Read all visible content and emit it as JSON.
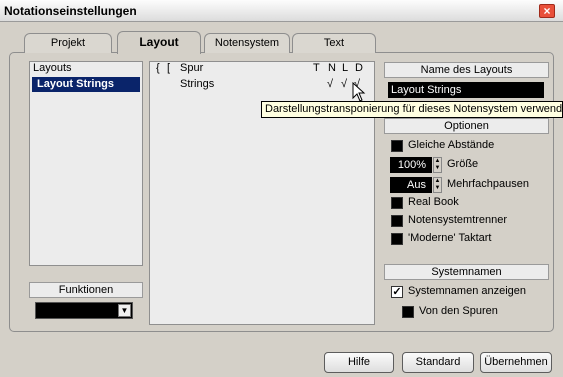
{
  "window": {
    "title": "Notationseinstellungen",
    "close_glyph": "×"
  },
  "tabs": [
    {
      "label": "Projekt",
      "active": false
    },
    {
      "label": "Layout",
      "active": true
    },
    {
      "label": "Notensystem",
      "active": false
    },
    {
      "label": "Text",
      "active": false
    }
  ],
  "layouts": {
    "header": "Layouts",
    "items": [
      "Layout Strings"
    ]
  },
  "funktionen": {
    "header": "Funktionen",
    "value": ""
  },
  "spur_table": {
    "columns": [
      "{",
      "[",
      "Spur",
      "T",
      "N",
      "L",
      "D"
    ],
    "rows": [
      {
        "name": "Strings",
        "T": "",
        "N": "√",
        "L": "√",
        "D": "√"
      }
    ]
  },
  "tooltip": "Darstellungstransponierung für dieses Notensystem verwenden",
  "layout_name": {
    "header": "Name des Layouts",
    "value": "Layout Strings"
  },
  "optionen": {
    "header": "Optionen",
    "gleiche_abstaende": "Gleiche Abstände",
    "groesse_value": "100%",
    "groesse_label": "Größe",
    "mehrfachpausen_value": "Aus",
    "mehrfachpausen_label": "Mehrfachpausen",
    "real_book": "Real Book",
    "notensystemtrenner": "Notensystemtrenner",
    "moderne_taktart": "'Moderne' Taktart"
  },
  "systemnamen": {
    "header": "Systemnamen",
    "anzeigen": "Systemnamen anzeigen",
    "anzeigen_checked": true,
    "von_den_spuren": "Von den Spuren"
  },
  "buttons": {
    "hilfe": "Hilfe",
    "standard": "Standard",
    "uebernehmen": "Übernehmen"
  },
  "colors": {
    "selection": "#0a246a",
    "dialog_bg": "#d4d0c8",
    "tooltip_bg": "#ffffe1"
  }
}
